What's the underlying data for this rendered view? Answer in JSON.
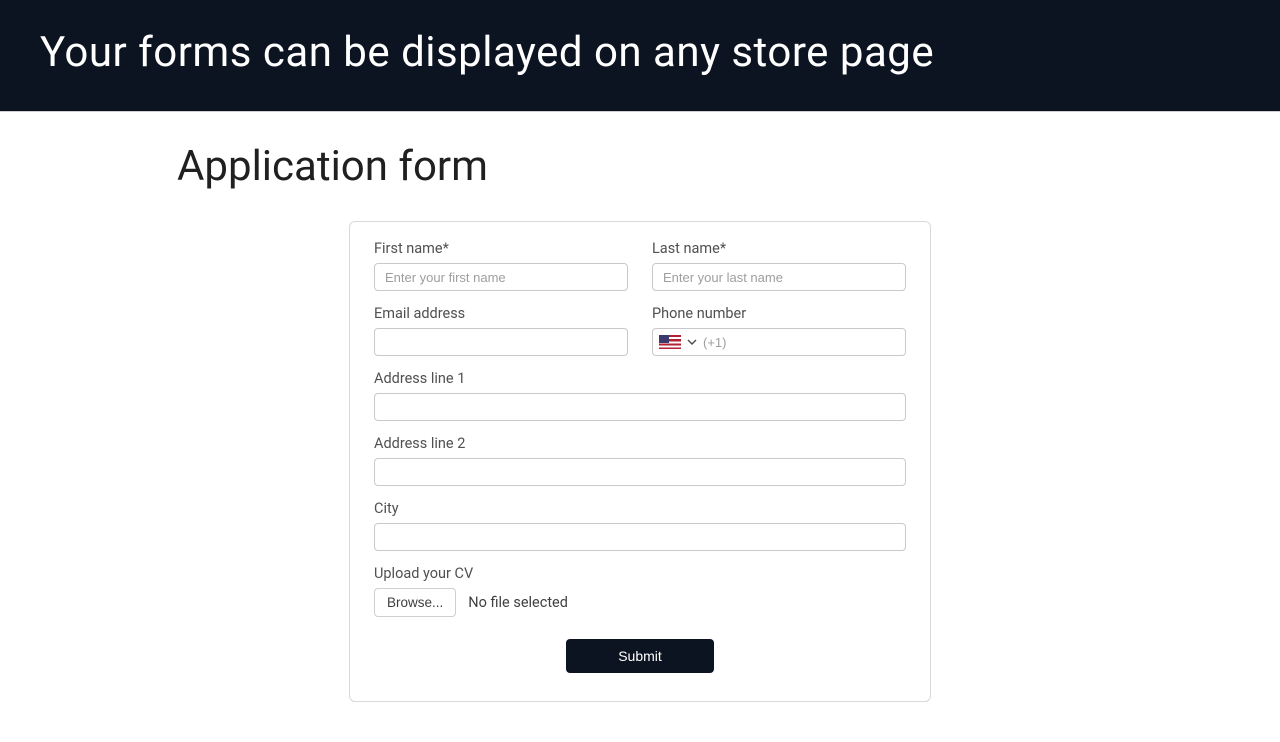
{
  "banner": {
    "headline": "Your forms can be displayed on any store page"
  },
  "page": {
    "title": "Application form"
  },
  "form": {
    "firstName": {
      "label": "First name*",
      "placeholder": "Enter your first name"
    },
    "lastName": {
      "label": "Last name*",
      "placeholder": "Enter your last name"
    },
    "email": {
      "label": "Email address"
    },
    "phone": {
      "label": "Phone number",
      "placeholder": "(+1)"
    },
    "address1": {
      "label": "Address line 1"
    },
    "address2": {
      "label": "Address line 2"
    },
    "city": {
      "label": "City"
    },
    "upload": {
      "label": "Upload your CV",
      "browse": "Browse...",
      "status": "No file selected"
    },
    "submit": "Submit"
  }
}
